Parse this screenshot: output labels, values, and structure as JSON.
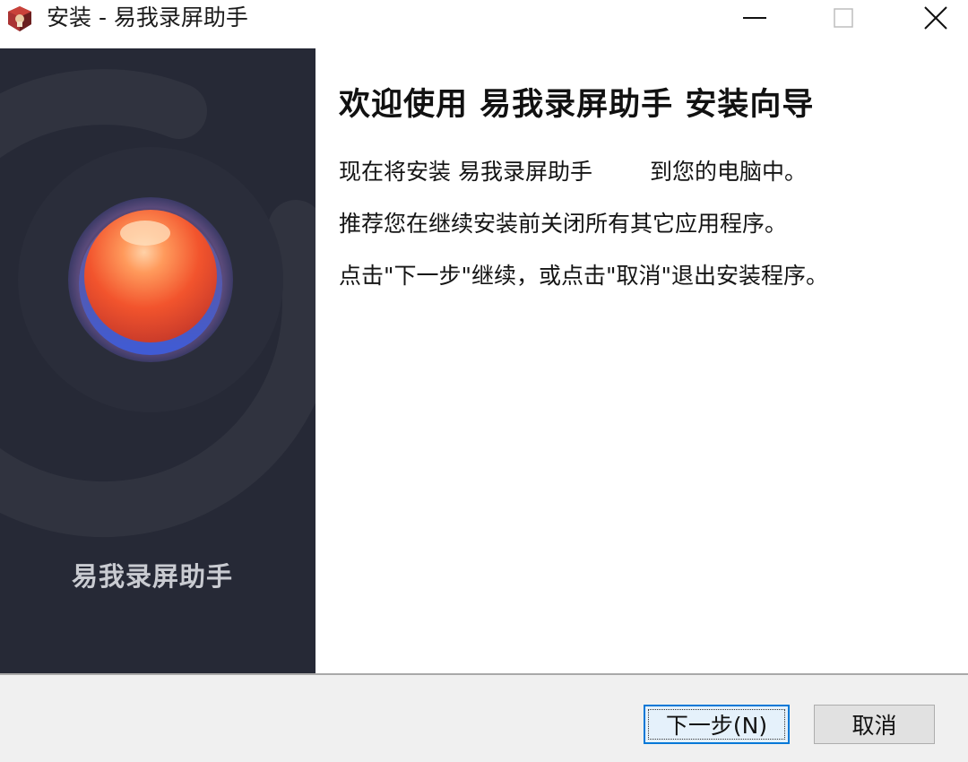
{
  "window": {
    "title": "安装 - 易我录屏助手",
    "icons": {
      "app": "installer-box-icon",
      "minimize": "minimize-icon",
      "maximize": "maximize-icon",
      "close": "close-icon"
    }
  },
  "banner": {
    "product_name": "易我录屏助手",
    "logo": "record-orb-icon",
    "colors": {
      "background": "#262936",
      "orb": "#f2542d"
    }
  },
  "content": {
    "title": "欢迎使用 易我录屏助手 安装向导",
    "line1_prefix": "现在将安装 易我录屏助手",
    "line1_suffix": "到您的电脑中。",
    "line2": "推荐您在继续安装前关闭所有其它应用程序。",
    "line3": "点击\"下一步\"继续，或点击\"取消\"退出安装程序。"
  },
  "footer": {
    "next_label": "下一步(N)",
    "cancel_label": "取消",
    "accent_color": "#0078d7"
  }
}
